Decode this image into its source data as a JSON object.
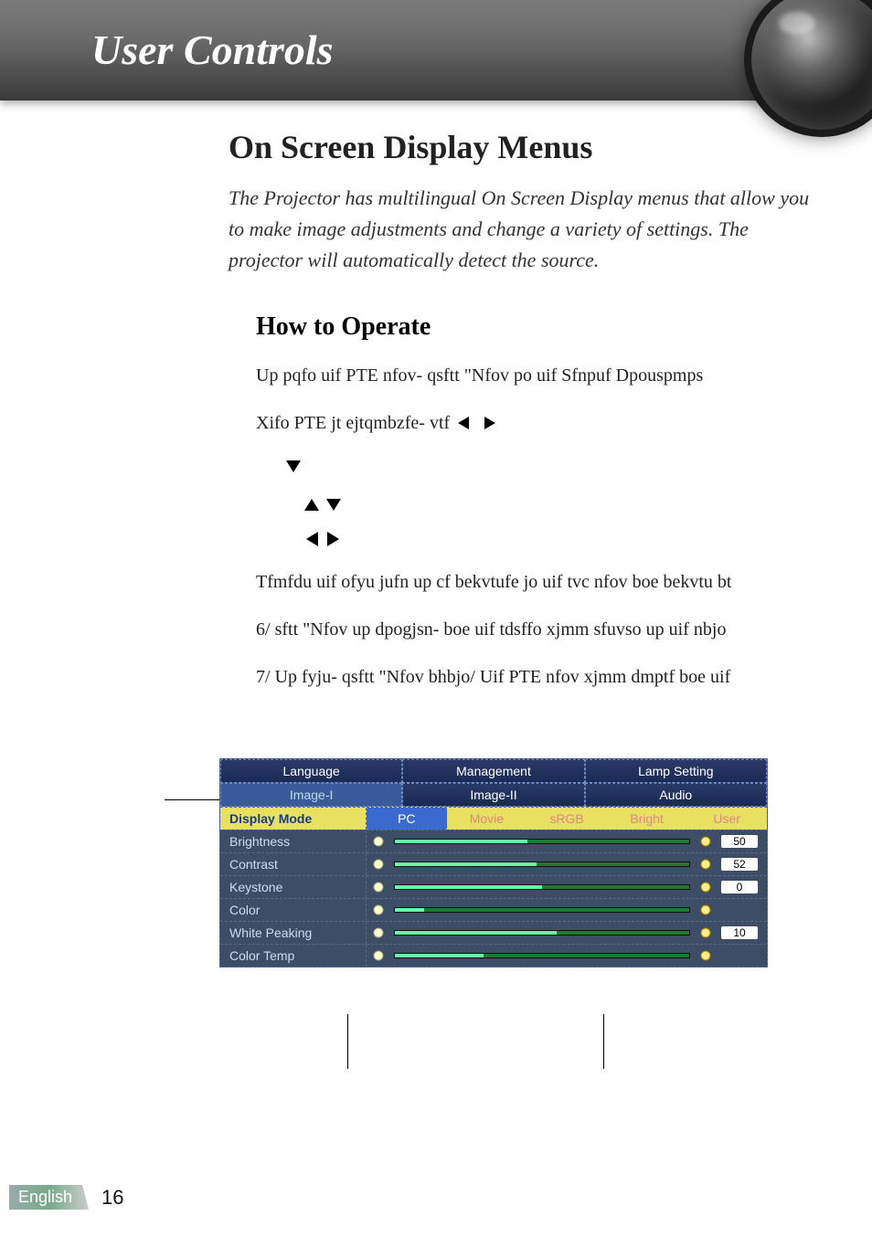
{
  "header": {
    "title": "User Controls"
  },
  "section": {
    "h1": "On Screen Display Menus",
    "intro": "The Projector has multilingual On Screen Display menus that allow you to make image adjustments and change a variety of settings. The projector will automatically detect the source.",
    "h2": "How to Operate",
    "step1": "Up pqfo uif PTE nfov- qsftt \"Nfov  po uif Sfnpuf Dpouspmps",
    "step2": "Xifo PTE jt ejtqmbzfe- vtf",
    "step4": "Tfmfdu uif ofyu jufn up cf bekvtufe jo uif tvc nfov boe bekvtu bt",
    "step5_num": "6/",
    "step5": "  sftt \"Nfov  up dpogjsn- boe uif tdsffo xjmm sfuvso up uif nbjo",
    "step6_num": "7/",
    "step6": " Up fyju- qsftt \"Nfov  bhbjo/ Uif PTE nfov xjmm dmptf boe uif"
  },
  "osd": {
    "tabs_row1": [
      "Language",
      "Management",
      "Lamp Setting"
    ],
    "tabs_row2": [
      "Image-I",
      "Image-II",
      "Audio"
    ],
    "selected_tab": "Image-I",
    "modes": [
      "PC",
      "Movie",
      "sRGB",
      "Bright",
      "User"
    ],
    "selected_mode": "PC",
    "rows": [
      {
        "label": "Display Mode",
        "type": "modes"
      },
      {
        "label": "Brightness",
        "type": "slider",
        "value": "50",
        "fill": 45
      },
      {
        "label": "Contrast",
        "type": "slider",
        "value": "52",
        "fill": 48
      },
      {
        "label": "Keystone",
        "type": "slider",
        "value": "0",
        "fill": 50
      },
      {
        "label": "Color",
        "type": "slider",
        "value": "",
        "fill": 10
      },
      {
        "label": "White Peaking",
        "type": "slider",
        "value": "10",
        "fill": 55
      },
      {
        "label": "Color Temp",
        "type": "slider",
        "value": "",
        "fill": 30
      }
    ]
  },
  "footer": {
    "language": "English",
    "page": "16"
  }
}
